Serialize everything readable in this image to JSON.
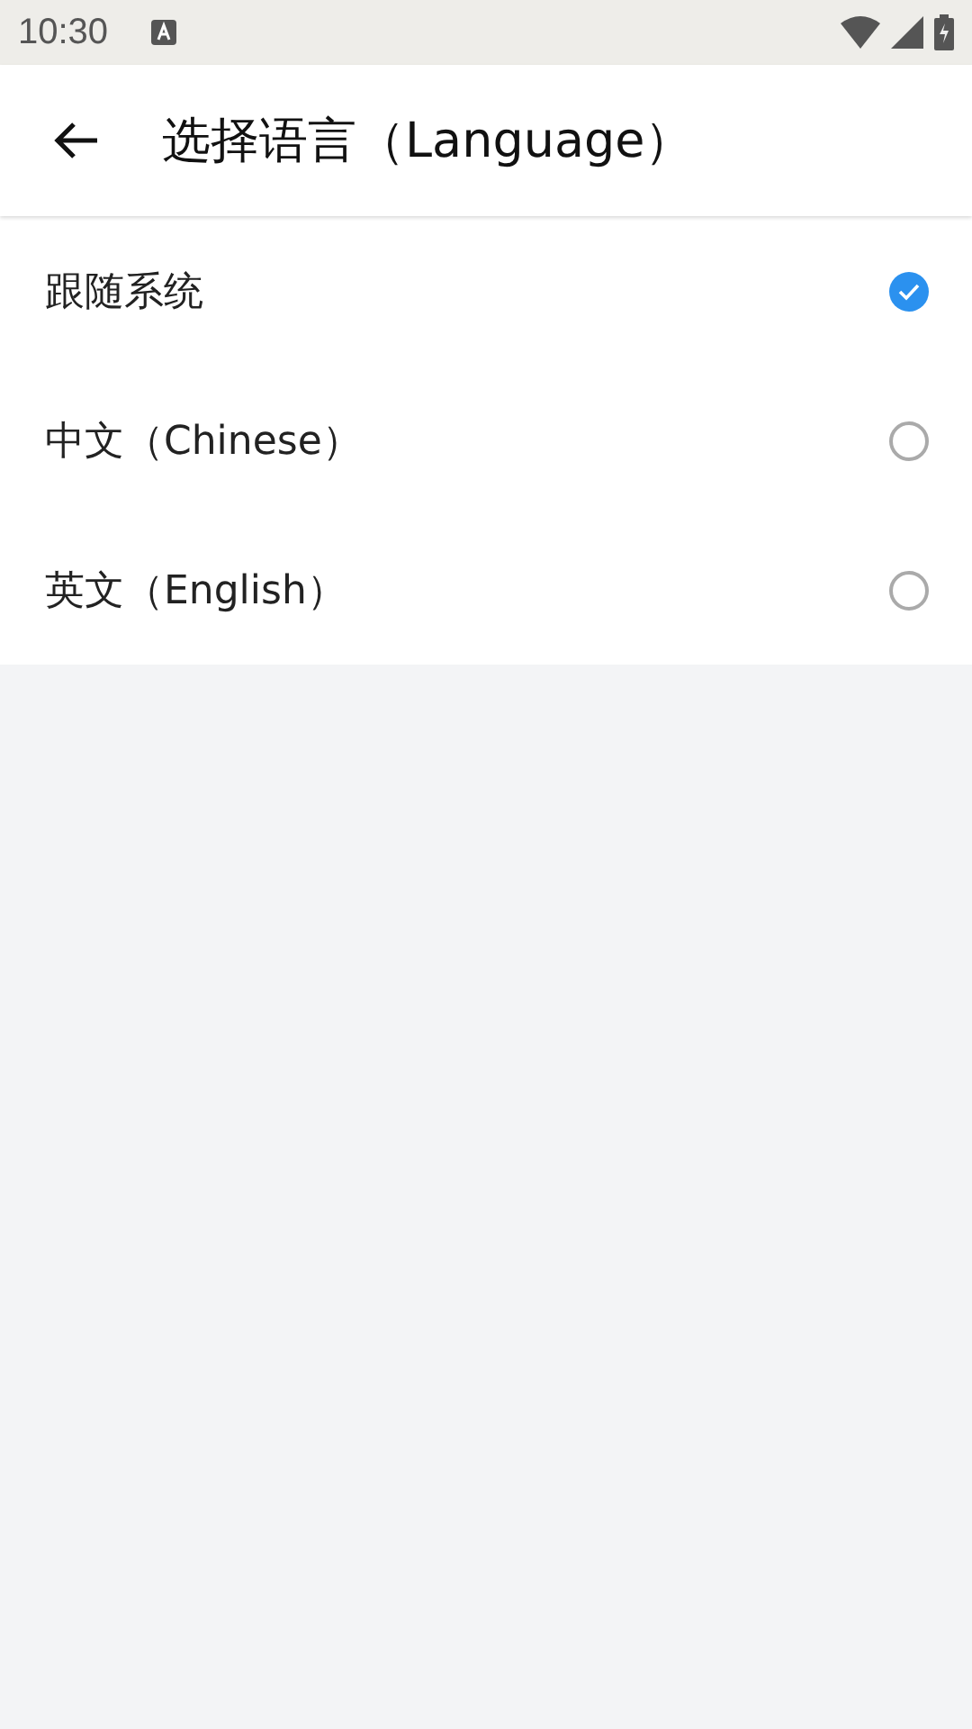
{
  "status_bar": {
    "time": "10:30"
  },
  "app_bar": {
    "title": "选择语言（Language）"
  },
  "options": [
    {
      "label": "跟随系统",
      "selected": true
    },
    {
      "label": "中文（Chinese）",
      "selected": false
    },
    {
      "label": "英文（English）",
      "selected": false
    }
  ]
}
